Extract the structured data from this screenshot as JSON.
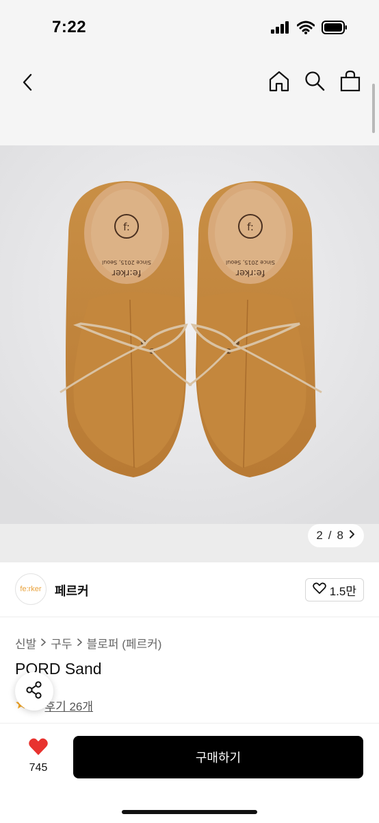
{
  "status_bar": {
    "time": "7:22",
    "icons": [
      "signal-icon",
      "wifi-icon",
      "battery-icon"
    ]
  },
  "nav": {
    "icons": [
      "back-icon",
      "home-icon",
      "search-icon",
      "shopping-bag-icon"
    ]
  },
  "gallery": {
    "current": "2",
    "separator": "/",
    "total": "8",
    "image": "tan suede lace-up mule clogs with fe:rker insole"
  },
  "insole_print": {
    "brand": "fe:rker",
    "since": "Since 2015, Seoul",
    "logo": "f:"
  },
  "brand": {
    "logo_text": "fe:rker",
    "name": "페르커",
    "likes": "1.5만"
  },
  "breadcrumb": [
    "신발",
    "구두",
    "블로퍼 (페르커)"
  ],
  "product": {
    "title": "PORD Sand",
    "rating": "5",
    "reviews_label": "후기 26개"
  },
  "bottom": {
    "wish_count": "745",
    "buy_label": "구매하기"
  },
  "colors": {
    "accent": "#000000",
    "heart": "#e8332f",
    "star": "#f5a623",
    "brand_logo": "#e8a13a"
  }
}
